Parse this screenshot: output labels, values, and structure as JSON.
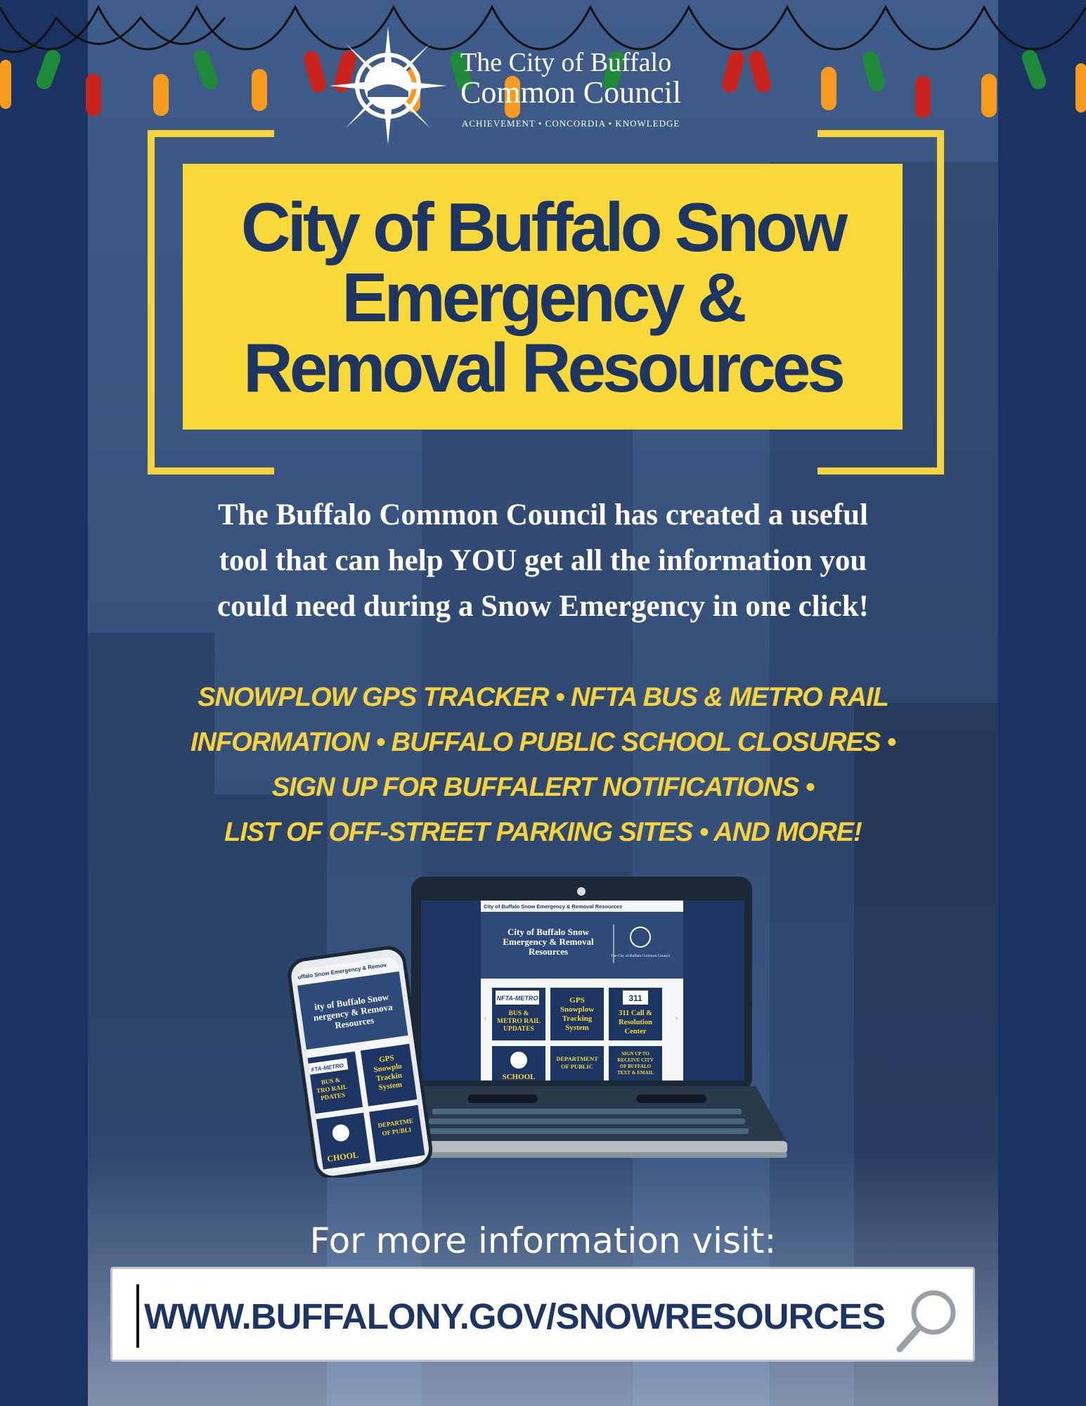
{
  "brand": {
    "org_line1": "The City of Buffalo",
    "org_line2": "Common Council",
    "motto": "ACHIEVEMENT  •  CONCORDIA  •  KNOWLEDGE"
  },
  "title": {
    "line1": "City of Buffalo Snow",
    "line2": "Emergency &",
    "line3": "Removal Resources"
  },
  "intro": {
    "line1": "The Buffalo Common Council has created a useful",
    "line2": "tool that can help YOU get all the information you",
    "line3": "could need during a Snow Emergency in one click!"
  },
  "features": {
    "line1": "SNOWPLOW GPS TRACKER • NFTA BUS & METRO RAIL",
    "line2": "INFORMATION • BUFFALO PUBLIC SCHOOL CLOSURES •",
    "line3": "SIGN UP FOR BUFFALERT NOTIFICATIONS •",
    "line4": "LIST OF OFF-STREET PARKING SITES • AND MORE!"
  },
  "laptop_screen": {
    "header": "City of Buffalo Snow Emergency & Removal Resources",
    "banner_line1": "City of Buffalo Snow",
    "banner_line2": "Emergency & Removal",
    "banner_line3": "Resources",
    "seal_caption": "The City of Buffalo Common Council",
    "tile1_logo": "NFTA-METRO",
    "tile1_l1": "BUS &",
    "tile1_l2": "METRO RAIL",
    "tile1_l3": "UPDATES",
    "tile2_l1": "GPS",
    "tile2_l2": "Snowplow",
    "tile2_l3": "Tracking",
    "tile2_l4": "System",
    "tile3_logo": "311",
    "tile3_l1": "311 Call &",
    "tile3_l2": "Resolution",
    "tile3_l3": "Center",
    "tile4": "SCHOOL",
    "tile5_l1": "DEPARTMENT",
    "tile5_l2": "OF PUBLIC",
    "tile6_l1": "SIGN UP TO",
    "tile6_l2": "RECEIVE CITY",
    "tile6_l3": "OF BUFFALO",
    "tile6_l4": "TEXT & EMAIL"
  },
  "phone_screen": {
    "header": "uffalo Snow Emergency & Remov",
    "banner_line1": "ity of Buffalo Snow",
    "banner_line2": "nergency & Remova",
    "banner_line3": "Resources",
    "tile1_logo": "FTA-METRO",
    "tile1_l1": "BUS &",
    "tile1_l2": "TRO RAIL",
    "tile1_l3": "PDATES",
    "tile2_l1": "GPS",
    "tile2_l2": "Snowplo",
    "tile2_l3": "Trackin",
    "tile2_l4": "System",
    "tile3": "CHOOL",
    "tile4_l1": "DEPARTME",
    "tile4_l2": "OF PUBLI"
  },
  "cta": {
    "label": "For more information visit:",
    "url": "WWW.BUFFALONY.GOV/SNOWRESOURCES"
  },
  "colors": {
    "navy": "#1c3563",
    "yellow": "#f9d83a",
    "light_red": "#c8231d",
    "light_green": "#1f8a3a",
    "light_orange": "#f59b1f"
  },
  "icons": {
    "search": "magnifier-icon",
    "seal": "city-seal-icon",
    "lights": "string-lights-icon"
  }
}
